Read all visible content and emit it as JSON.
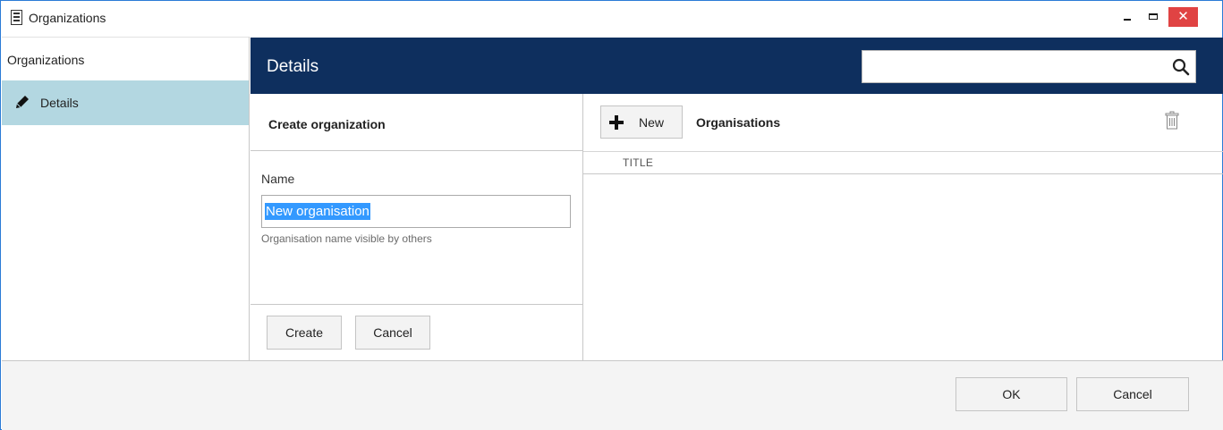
{
  "window": {
    "title": "Organizations",
    "close_glyph": "✕"
  },
  "sidebar": {
    "header": "Organizations",
    "items": [
      {
        "label": "Details",
        "icon": "pencil-icon",
        "selected": true
      }
    ]
  },
  "header": {
    "title": "Details",
    "search_value": "",
    "search_placeholder": ""
  },
  "create_form": {
    "title": "Create organization",
    "name_label": "Name",
    "name_value": "New organisation",
    "name_hint": "Organisation name visible by others",
    "create_label": "Create",
    "cancel_label": "Cancel"
  },
  "list": {
    "new_label": "New",
    "title": "Organisations",
    "columns": [
      "TITLE"
    ],
    "rows": []
  },
  "footer": {
    "ok_label": "OK",
    "cancel_label": "Cancel"
  },
  "colors": {
    "header_bg": "#0e2f5e",
    "selected_nav_bg": "#b3d7e1",
    "close_button": "#e04343",
    "selection": "#3399ff"
  }
}
